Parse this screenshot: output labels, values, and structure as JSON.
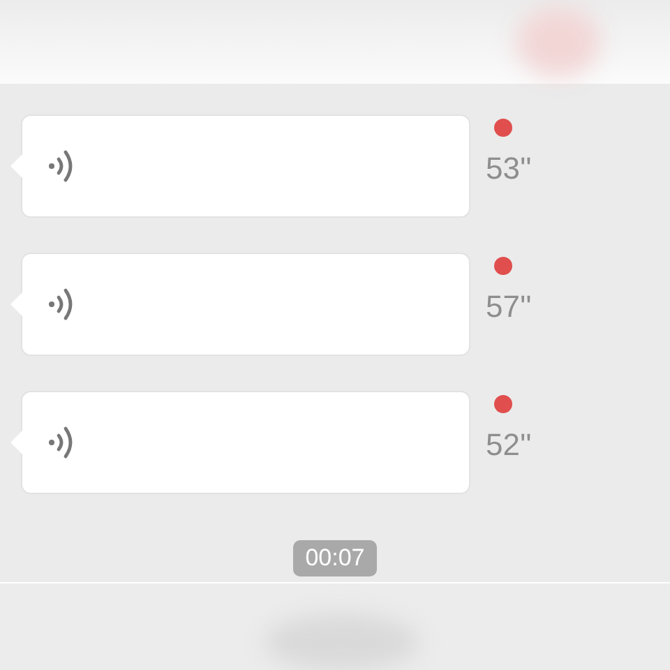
{
  "messages": [
    {
      "kind": "voice",
      "duration": "53''",
      "unread": true
    },
    {
      "kind": "voice",
      "duration": "57''",
      "unread": true
    },
    {
      "kind": "voice",
      "duration": "52''",
      "unread": true
    }
  ],
  "time_badge": "00:07"
}
